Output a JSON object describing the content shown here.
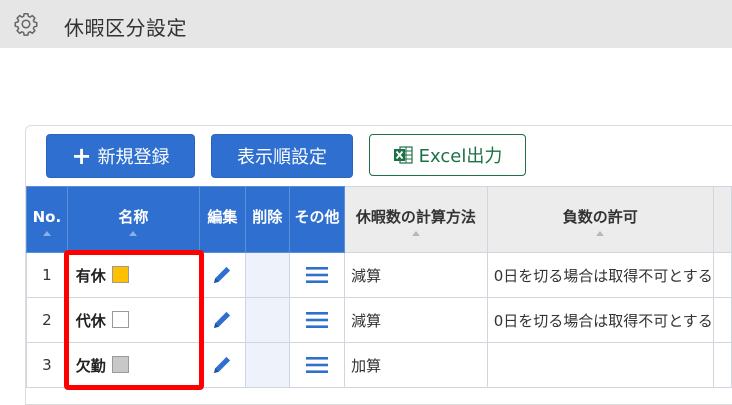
{
  "header": {
    "title": "休暇区分設定",
    "icon": "gear-icon"
  },
  "toolbar": {
    "new_label": "新規登録",
    "order_label": "表示順設定",
    "excel_label": "Excel出力"
  },
  "table": {
    "columns": [
      "No.",
      "名称",
      "編集",
      "削除",
      "その他",
      "休暇数の計算方法",
      "負数の許可"
    ],
    "rows": [
      {
        "no": "1",
        "name": "有休",
        "swatch": "#ffc000",
        "method": "減算",
        "negative": "0日を切る場合は取得不可とする"
      },
      {
        "no": "2",
        "name": "代休",
        "swatch": "#ffffff",
        "method": "減算",
        "negative": "0日を切る場合は取得不可とする"
      },
      {
        "no": "3",
        "name": "欠勤",
        "swatch": "#c8c8c8",
        "method": "加算",
        "negative": ""
      }
    ]
  },
  "colors": {
    "primary": "#2f6fcf",
    "excel_green": "#1e7145",
    "highlight": "#ff0000"
  }
}
